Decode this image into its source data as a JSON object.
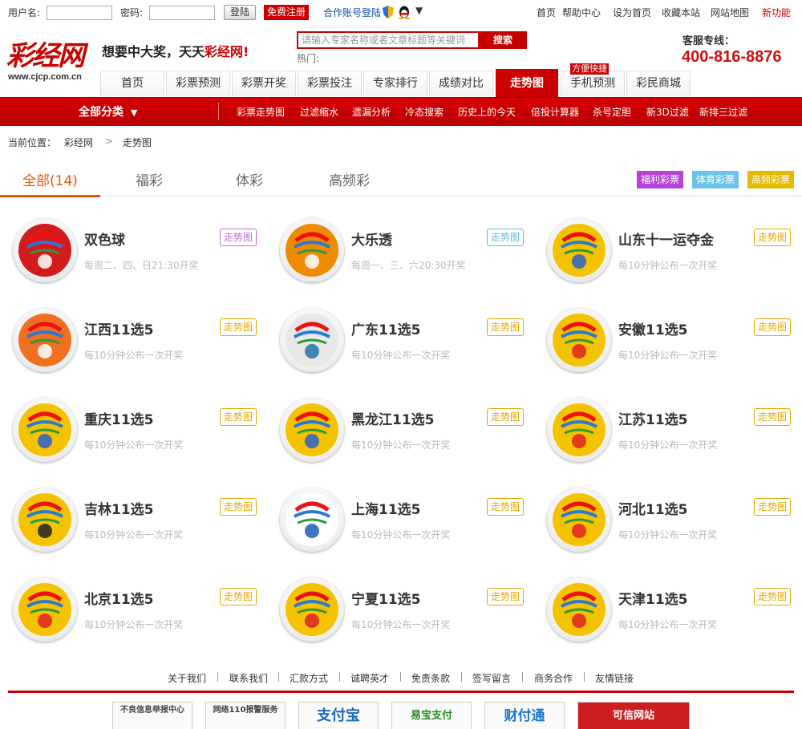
{
  "topbar": {
    "username_label": "用户名:",
    "password_label": "密码:",
    "username_value": "",
    "password_value": "",
    "login_label": "登陆",
    "register_label": "免费注册",
    "partner_label": "合作账号登陆",
    "links": [
      "首页",
      "帮助中心",
      "设为首页",
      "收藏本站",
      "网站地图",
      "新功能"
    ]
  },
  "header": {
    "logo_text": "彩经网",
    "logo_url": "www.cjcp.com.cn",
    "slogan_prefix": "想要中大奖，天天",
    "slogan_brand": "彩经网!",
    "search_placeholder": "请输入专家名称或者文章标题等关键词",
    "search_button": "搜索",
    "hot_label": "热门:",
    "service_label": "客服专线：",
    "service_phone": "400-816-8876"
  },
  "nav": {
    "tabs": [
      "首页",
      "彩票预测",
      "彩票开奖",
      "彩票投注",
      "专家排行",
      "成绩对比",
      "走势图",
      "手机预测",
      "彩民商城"
    ],
    "badge": "方便快捷"
  },
  "subbar": {
    "all_label": "全部分类",
    "links": [
      "彩票走势图",
      "过滤缩水",
      "遗漏分析",
      "冷态搜索",
      "历史上的今天",
      "倍投计算器",
      "杀号定胆",
      "新3D过滤",
      "新排三过滤"
    ]
  },
  "breadcrumb": {
    "prefix": "当前位置：",
    "items": [
      "彩经网",
      "走势图"
    ],
    "separator": ">"
  },
  "category_tabs": {
    "tabs": [
      "全部(14)",
      "福彩",
      "体彩",
      "高频彩"
    ],
    "pills": [
      "福利彩票",
      "体育彩票",
      "高频彩票"
    ],
    "colors": {
      "active": "#ee5500",
      "fucai": "#b444d9",
      "ticai": "#6cc3ea",
      "gaopin": "#e6b800"
    }
  },
  "lotteries": [
    {
      "name": "双色球",
      "schedule": "每周二、四、日21:30开奖",
      "trend": "走势图",
      "border": "#c06ad8",
      "icon": "ssq-logo-icon"
    },
    {
      "name": "大乐透",
      "schedule": "每周一、三、六20:30开奖",
      "trend": "走势图",
      "border": "#5bbde6",
      "icon": "dlt-logo-icon"
    },
    {
      "name": "山东十一运夺金",
      "schedule": "每10分钟公布一次开奖",
      "trend": "走势图",
      "border": "#e6a700",
      "icon": "sd11-logo-icon"
    },
    {
      "name": "江西11选5",
      "schedule": "每10分钟公布一次开奖",
      "trend": "走势图",
      "border": "#e6a700",
      "icon": "jx11x5-logo-icon"
    },
    {
      "name": "广东11选5",
      "schedule": "每10分钟公布一次开奖",
      "trend": "走势图",
      "border": "#e6a700",
      "icon": "gd11x5-logo-icon"
    },
    {
      "name": "安徽11选5",
      "schedule": "每10分钟公布一次开奖",
      "trend": "走势图",
      "border": "#e6a700",
      "icon": "ah11x5-logo-icon"
    },
    {
      "name": "重庆11选5",
      "schedule": "每10分钟公布一次开奖",
      "trend": "走势图",
      "border": "#e6a700",
      "icon": "cq11x5-logo-icon"
    },
    {
      "name": "黑龙江11选5",
      "schedule": "每10分钟公布一次开奖",
      "trend": "走势图",
      "border": "#e6a700",
      "icon": "hlj11x5-logo-icon"
    },
    {
      "name": "江苏11选5",
      "schedule": "每10分钟公布一次开奖",
      "trend": "走势图",
      "border": "#e6a700",
      "icon": "js11x5-logo-icon"
    },
    {
      "name": "吉林11选5",
      "schedule": "每10分钟公布一次开奖",
      "trend": "走势图",
      "border": "#e6a700",
      "icon": "jl11x5-logo-icon"
    },
    {
      "name": "上海11选5",
      "schedule": "每10分钟公布一次开奖",
      "trend": "走势图",
      "border": "#e6a700",
      "icon": "sh11x5-logo-icon"
    },
    {
      "name": "河北11选5",
      "schedule": "每10分钟公布一次开奖",
      "trend": "走势图",
      "border": "#e6a700",
      "icon": "hb11x5-logo-icon"
    },
    {
      "name": "北京11选5",
      "schedule": "每10分钟公布一次开奖",
      "trend": "走势图",
      "border": "#e6a700",
      "icon": "bj11x5-logo-icon"
    },
    {
      "name": "宁夏11选5",
      "schedule": "每10分钟公布一次开奖",
      "trend": "走势图",
      "border": "#e6a700",
      "icon": "nx11x5-logo-icon"
    },
    {
      "name": "天津11选5",
      "schedule": "每10分钟公布一次开奖",
      "trend": "走势图",
      "border": "#e6a700",
      "icon": "tj11x5-logo-icon"
    }
  ],
  "footer": {
    "links": [
      "关于我们",
      "联系我们",
      "汇款方式",
      "诚聘英才",
      "免责条款",
      "签写留言",
      "商务合作",
      "友情链接"
    ],
    "badges": [
      "不良信息举报中心",
      "网络110报警服务",
      "支付宝",
      "易宝支付",
      "财付通",
      "可信网站"
    ]
  },
  "colors": {
    "brand_red": "#cc0000",
    "accent_orange": "#ee5500",
    "trend_gold": "#e6a700"
  }
}
